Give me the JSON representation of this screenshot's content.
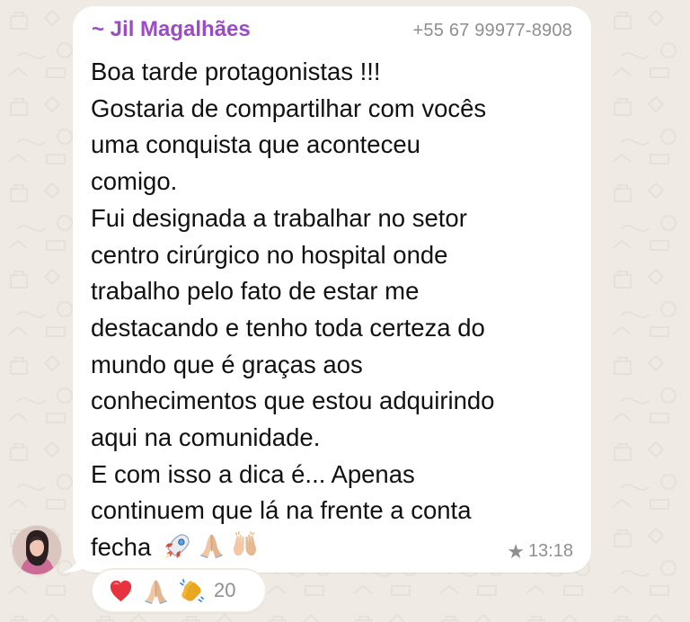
{
  "message": {
    "sender_name": "~ Jil Magalhães",
    "sender_phone": "+55 67 99977-8908",
    "lines": [
      "Boa tarde protagonistas !!!",
      "Gostaria de compartilhar com vocês",
      "uma conquista que aconteceu",
      "comigo.",
      "Fui designada a trabalhar no setor",
      "centro cirúrgico no hospital onde",
      "trabalho pelo fato de estar me",
      "destacando e tenho toda certeza do",
      "mundo que é graças aos",
      "conhecimentos que estou adquirindo",
      "aqui na comunidade.",
      "E com isso a dica é... Apenas",
      "continuem que lá na frente a conta",
      "fecha"
    ],
    "inline_emojis": [
      "rocket-icon",
      "praying-hands-icon",
      "raising-hands-icon"
    ],
    "time": "13:18",
    "starred": true
  },
  "reactions": {
    "emojis": [
      "heart-icon",
      "praying-hands-icon",
      "clapping-hands-icon"
    ],
    "count": "20"
  },
  "colors": {
    "background": "#efebe4",
    "bubble": "#ffffff",
    "sender_name": "#9b4bc7",
    "meta_text": "#8f8f8f",
    "message_text": "#111111"
  }
}
